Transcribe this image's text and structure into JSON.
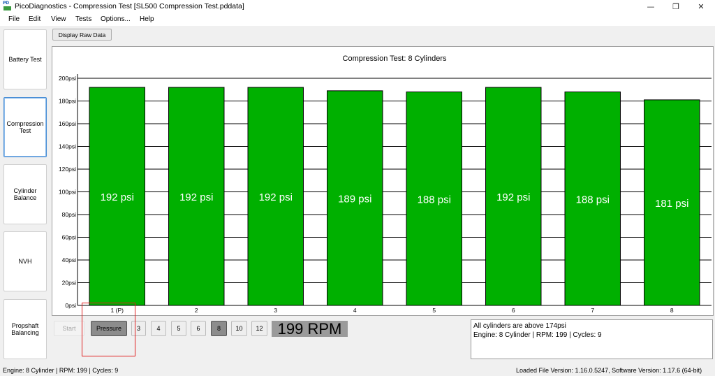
{
  "window": {
    "title": "PicoDiagnostics - Compression Test [SL500 Compression Test.pddata]",
    "icon_top": "PD",
    "minimize_glyph": "—",
    "maximize_glyph": "❐",
    "close_glyph": "✕"
  },
  "menu": [
    "File",
    "Edit",
    "View",
    "Tests",
    "Options...",
    "Help"
  ],
  "sidebar": [
    {
      "label": "Battery Test",
      "active": false
    },
    {
      "label": "Compression Test",
      "active": true
    },
    {
      "label": "Cylinder Balance",
      "active": false
    },
    {
      "label": "NVH",
      "active": false
    },
    {
      "label": "Propshaft Balancing",
      "active": false
    }
  ],
  "toolbar": {
    "display_raw_data": "Display Raw Data"
  },
  "chart_data": {
    "type": "bar",
    "title": "Compression Test: 8 Cylinders",
    "categories": [
      "1 (P)",
      "2",
      "3",
      "4",
      "5",
      "6",
      "7",
      "8"
    ],
    "values": [
      192,
      192,
      192,
      189,
      188,
      192,
      188,
      181
    ],
    "data_labels": [
      "192 psi",
      "192 psi",
      "192 psi",
      "189 psi",
      "188 psi",
      "192 psi",
      "188 psi",
      "181 psi"
    ],
    "y_ticks": [
      "0psi",
      "20psi",
      "40psi",
      "60psi",
      "80psi",
      "100psi",
      "120psi",
      "140psi",
      "160psi",
      "180psi",
      "200psi"
    ],
    "ylim": [
      0,
      200
    ],
    "grid": true,
    "bar_color": "#00b000"
  },
  "controls": {
    "start": "Start",
    "pressure": "Pressure",
    "cylinder_options": [
      "3",
      "4",
      "5",
      "6",
      "8",
      "10",
      "12"
    ],
    "selected_cylinders": "8",
    "rpm": "199 RPM"
  },
  "info": {
    "line1": "All cylinders are above 174psi",
    "line2": "Engine: 8 Cylinder | RPM: 199 | Cycles: 9"
  },
  "status": {
    "left": "Engine: 8 Cylinder | RPM: 199 | Cycles: 9",
    "right": "Loaded File Version: 1.16.0.5247,  Software Version: 1.17.6 (64-bit)"
  }
}
